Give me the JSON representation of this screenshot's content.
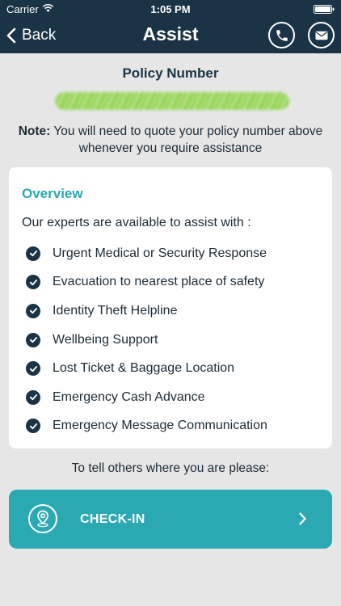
{
  "status_bar": {
    "carrier": "Carrier",
    "time": "1:05 PM"
  },
  "nav": {
    "back_label": "Back",
    "title": "Assist"
  },
  "policy": {
    "title": "Policy Number",
    "note_label": "Note:",
    "note_text": " You will need to quote your policy number above whenever you require assistance"
  },
  "overview": {
    "title": "Overview",
    "intro": "Our experts are available to assist with :",
    "items": [
      "Urgent Medical or Security Response",
      "Evacuation to nearest place of safety",
      "Identity Theft Helpline",
      "Wellbeing Support",
      "Lost Ticket & Baggage Location",
      "Emergency Cash Advance",
      "Emergency Message Communication"
    ]
  },
  "checkin": {
    "prompt": "To tell others where you are please:",
    "button_label": "CHECK-IN"
  },
  "colors": {
    "header": "#1b3445",
    "accent": "#2aa9b3",
    "background": "#e6e6e6"
  }
}
